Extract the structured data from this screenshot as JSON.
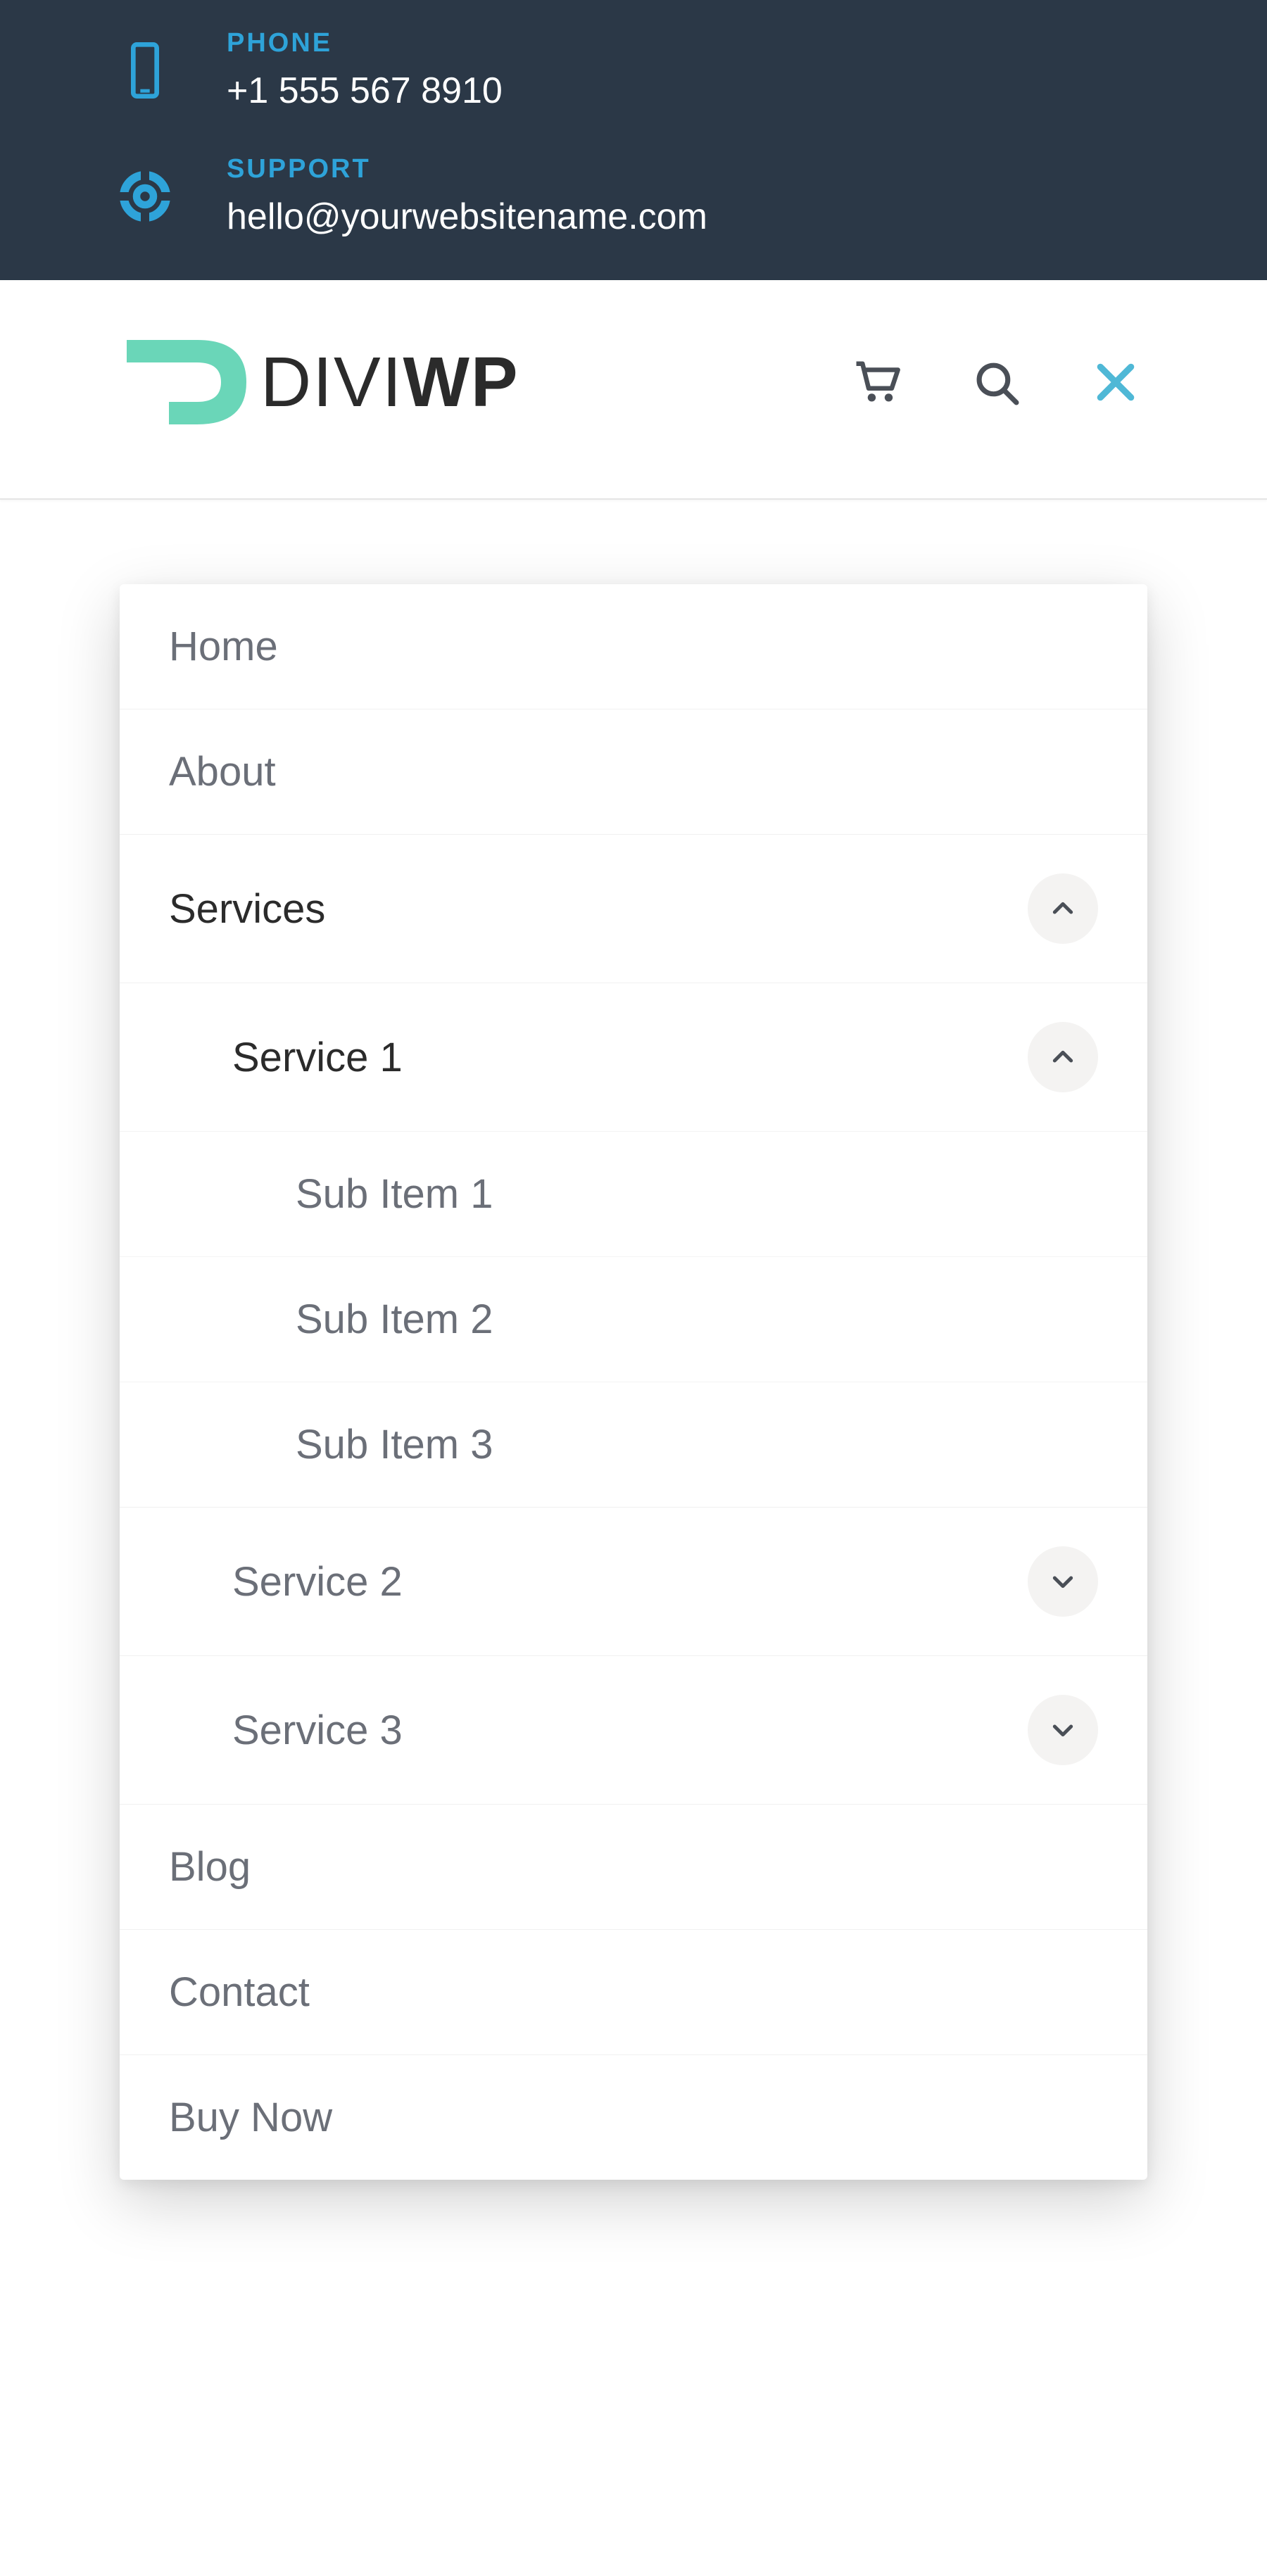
{
  "topbar": {
    "phone_label": "PHONE",
    "phone_value": "+1 555 567 8910",
    "support_label": "SUPPORT",
    "support_value": "hello@yourwebsitename.com"
  },
  "logo": {
    "text_light": "DIVI",
    "text_bold": "WP"
  },
  "nav": {
    "home": "Home",
    "about": "About",
    "services": "Services",
    "service1": "Service 1",
    "service1_sub1": "Sub Item 1",
    "service1_sub2": "Sub Item 2",
    "service1_sub3": "Sub Item 3",
    "service2": "Service 2",
    "service3": "Service 3",
    "blog": "Blog",
    "contact": "Contact",
    "buy_now": "Buy Now"
  },
  "colors": {
    "topbar_bg": "#2b3847",
    "accent_blue": "#2ea3d9",
    "logo_teal": "#6ad6b8",
    "text_dark": "#2b2b2b",
    "text_muted": "#6b6f78"
  }
}
